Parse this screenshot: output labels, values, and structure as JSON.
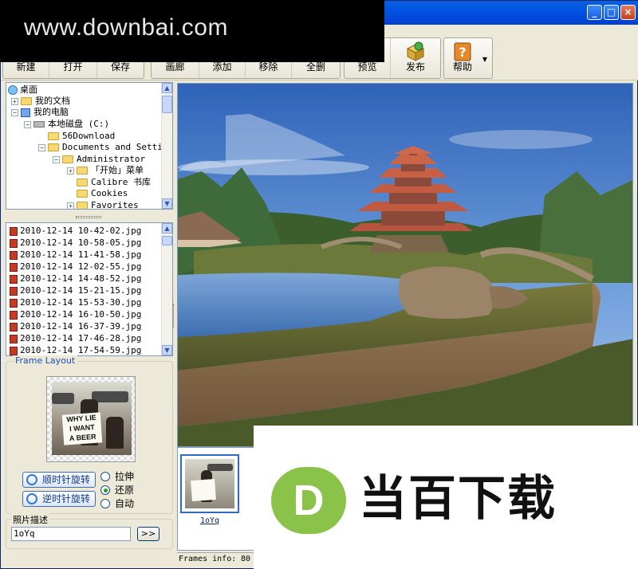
{
  "watermark": {
    "text": "www.downbai.com"
  },
  "titlebar": {
    "min": "_",
    "max": "□",
    "close": "×"
  },
  "toolbar": {
    "file_group": [
      "新建",
      "打开",
      "保存"
    ],
    "edit_group": [
      "画廊",
      "添加",
      "移除",
      "全删"
    ],
    "preview": "预览",
    "publish": "发布",
    "help": "帮助"
  },
  "tree": {
    "items": [
      {
        "label": "桌面",
        "type": "desktop"
      },
      {
        "label": "我的文档",
        "type": "folder",
        "toggle": "+"
      },
      {
        "label": "我的电脑",
        "type": "pc",
        "toggle": "−"
      },
      {
        "label": "本地磁盘 (C:)",
        "type": "drive",
        "toggle": "−"
      },
      {
        "label": "56Download",
        "type": "folder"
      },
      {
        "label": "Documents and Settings",
        "type": "folder",
        "toggle": "−"
      },
      {
        "label": "Administrator",
        "type": "folder",
        "toggle": "−"
      },
      {
        "label": "「开始」菜单",
        "type": "folder",
        "toggle": "+"
      },
      {
        "label": "Calibre 书库",
        "type": "folder"
      },
      {
        "label": "Cookies",
        "type": "folder"
      },
      {
        "label": "Favorites",
        "type": "folder",
        "toggle": "+"
      }
    ]
  },
  "files": [
    "2010-12-14 10-42-02.jpg",
    "2010-12-14 10-58-05.jpg",
    "2010-12-14 11-41-58.jpg",
    "2010-12-14 12-02-55.jpg",
    "2010-12-14 14-48-52.jpg",
    "2010-12-14 15-21-15.jpg",
    "2010-12-14 15-53-30.jpg",
    "2010-12-14 16-10-50.jpg",
    "2010-12-14 16-37-39.jpg",
    "2010-12-14 17-46-28.jpg",
    "2010-12-14 17-54-59.jpg"
  ],
  "frame_layout": {
    "legend": "Frame Layout",
    "sign_lines": [
      "WHY LIE",
      "I WANT",
      "A BEER"
    ],
    "rotate_cw": "顺时针旋转",
    "rotate_ccw": "逆时针旋转",
    "options": [
      "拉伸",
      "还原",
      "自动"
    ],
    "selected": "还原"
  },
  "description": {
    "legend": "照片描述",
    "value": "1oYq",
    "button": ">>"
  },
  "thumbnail": {
    "label": "1oYq"
  },
  "status": {
    "label": "Frames info:",
    "value": "80"
  },
  "brand": {
    "letter": "D",
    "text": "当百下载",
    "color": "#8bc34a"
  }
}
